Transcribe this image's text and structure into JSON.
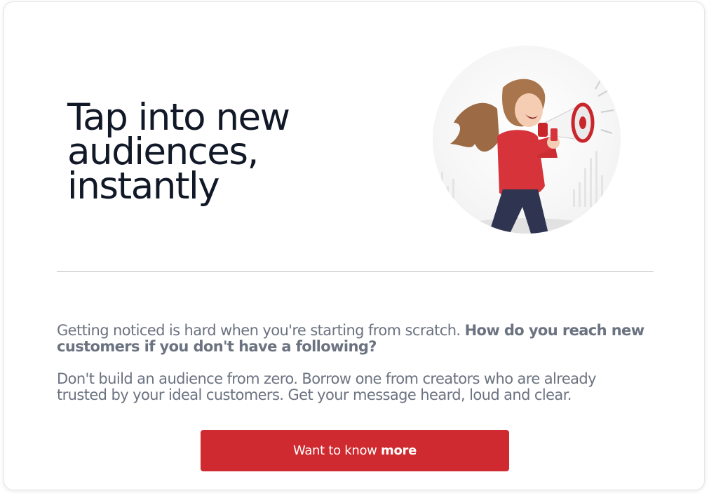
{
  "hero": {
    "headline_lines": [
      "Tap into new",
      "audiences,",
      "instantly"
    ],
    "image_icon": "woman-with-megaphone-illustration"
  },
  "body": {
    "paragraph1_regular": "Getting noticed is hard when you're starting from scratch. ",
    "paragraph1_bold": "How do you reach new customers if you don't have a following?",
    "paragraph2": "Don't build an audience from zero. Borrow one from creators who are already trusted by your ideal customers. Get your message heard, loud and clear."
  },
  "cta": {
    "label_regular": "Want to know ",
    "label_bold": "more"
  },
  "colors": {
    "accent": "#ce2a2f",
    "headline": "#111827",
    "body_text": "#6b7280",
    "divider": "#bdbdbd"
  }
}
